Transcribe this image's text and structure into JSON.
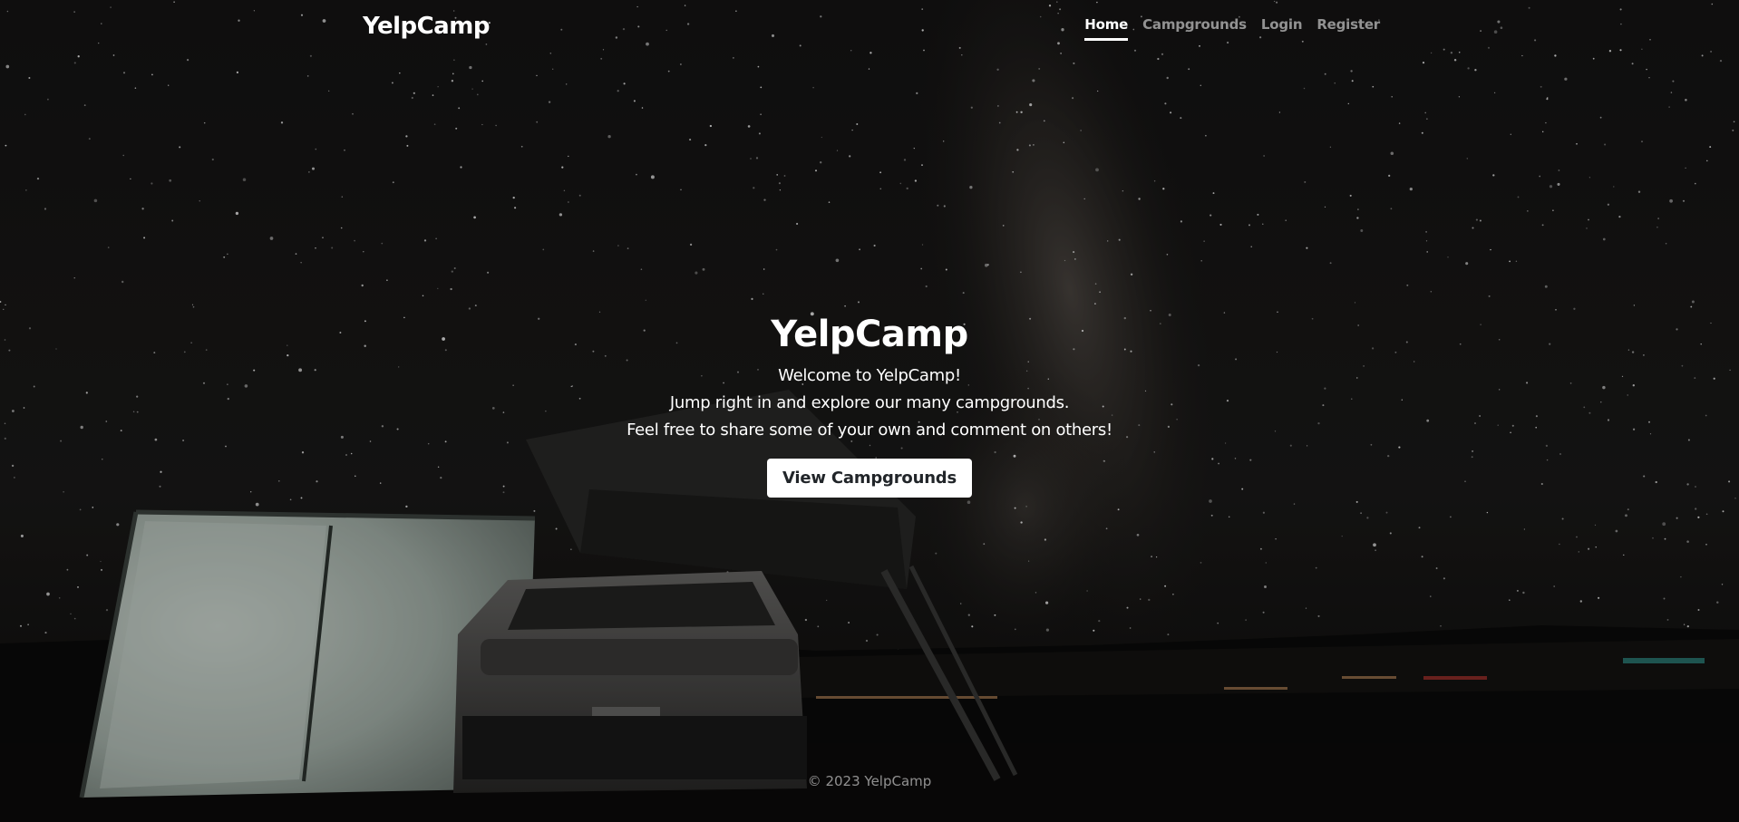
{
  "header": {
    "brand": "YelpCamp",
    "nav": [
      {
        "label": "Home",
        "active": true
      },
      {
        "label": "Campgrounds",
        "active": false
      },
      {
        "label": "Login",
        "active": false
      },
      {
        "label": "Register",
        "active": false
      }
    ]
  },
  "hero": {
    "title": "YelpCamp",
    "lines": [
      "Welcome to YelpCamp!",
      "Jump right in and explore our many campgrounds.",
      "Feel free to share some of your own and comment on others!"
    ],
    "cta_label": "View Campgrounds"
  },
  "footer": {
    "copyright": "© 2023 YelpCamp"
  },
  "colors": {
    "text": "#ffffff",
    "muted_nav": "#8c8c8c",
    "button_bg": "#ffffff",
    "button_text": "#212529"
  }
}
